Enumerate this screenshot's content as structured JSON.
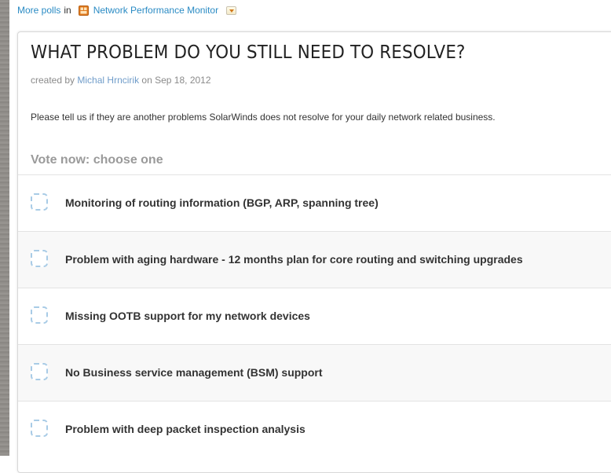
{
  "breadcrumb": {
    "more_polls": "More polls",
    "in_text": "in",
    "place_name": "Network Performance Monitor",
    "place_icon": "place-icon",
    "dropdown_icon": "chevron-down-icon"
  },
  "poll": {
    "title": "WHAT PROBLEM DO YOU STILL NEED TO RESOLVE?",
    "created_by_prefix": "created by",
    "author": "Michal Hrncirik",
    "date_prefix": "on",
    "date": "Sep 18, 2012",
    "description": "Please tell us if they are another problems SolarWinds does not resolve for your daily network related business.",
    "vote_heading": "Vote now: choose one",
    "options": [
      {
        "label": "Monitoring of routing information (BGP, ARP, spanning tree)"
      },
      {
        "label": "Problem with aging hardware - 12 months plan for core routing and switching upgrades"
      },
      {
        "label": "Missing OOTB support for my network devices"
      },
      {
        "label": "No Business service management (BSM) support"
      },
      {
        "label": "Problem with deep packet inspection analysis"
      }
    ]
  },
  "colors": {
    "link": "#2a8bc4",
    "author_link": "#6f9cc9",
    "checkbox_border": "#a8cbe6",
    "place_icon_orange": "#e07b20"
  }
}
